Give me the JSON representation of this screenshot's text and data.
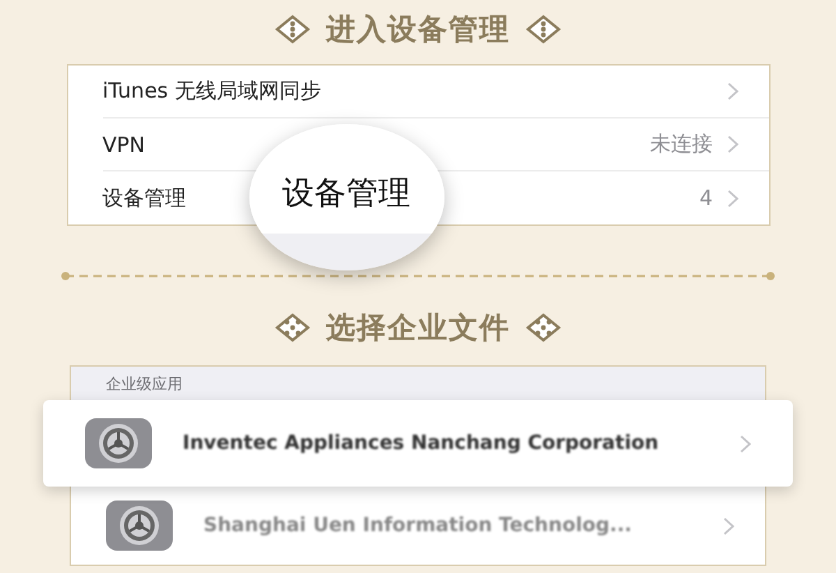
{
  "steps": [
    {
      "title": "进入设备管理",
      "marker": {
        "kind": "three-dots"
      },
      "settings_rows": [
        {
          "label": "iTunes 无线局域网同步"
        },
        {
          "label": "VPN",
          "value": "未连接"
        },
        {
          "label": "设备管理",
          "value": "4"
        }
      ],
      "magnifier": {
        "text": "设备管理"
      }
    },
    {
      "title": "选择企业文件",
      "marker": {
        "kind": "five-dots"
      },
      "list_header": "企业级应用",
      "apps": [
        {
          "name": "Inventec Appliances Nanchang Corporation",
          "highlighted": true
        },
        {
          "name": "Shanghai Uen Information Technolog...",
          "highlighted": false
        }
      ]
    }
  ]
}
